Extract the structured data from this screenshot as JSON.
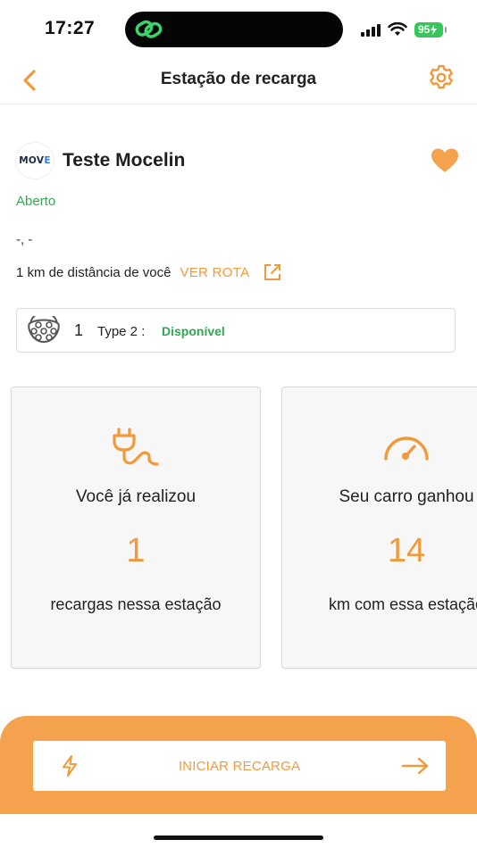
{
  "status_bar": {
    "time": "17:27",
    "battery": "95"
  },
  "header": {
    "title": "Estação de recarga"
  },
  "station": {
    "logo_text_main": "MOV",
    "logo_text_accent": "E",
    "name": "Teste Mocelin",
    "status": "Aberto",
    "address": "-, -",
    "distance": "1 km de distância de você",
    "route_label": "VER ROTA"
  },
  "connector": {
    "count": "1",
    "type": "Type 2 :",
    "status": "Disponível"
  },
  "stats": [
    {
      "heading": "Você já realizou",
      "value": "1",
      "caption": "recargas nessa estação"
    },
    {
      "heading": "Seu carro ganhou",
      "value": "14",
      "caption": "km com essa estação"
    }
  ],
  "action": {
    "start_label": "INICIAR RECARGA"
  },
  "colors": {
    "accent": "#f09a3b",
    "panel": "#f4a24d",
    "success": "#2fa84f"
  }
}
